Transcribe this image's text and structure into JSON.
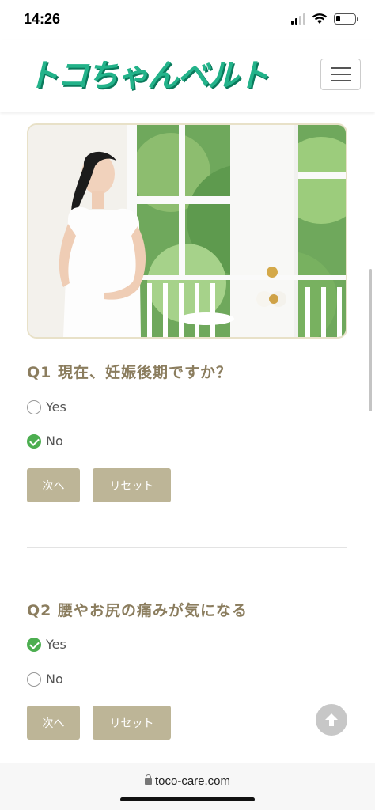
{
  "status_bar": {
    "time": "14:26"
  },
  "header": {
    "logo_text": "トコちゃんベルト",
    "menu_icon": "hamburger-menu-icon"
  },
  "questions": [
    {
      "title": "Q1 現在、妊娠後期ですか？",
      "options": [
        {
          "label": "Yes",
          "checked": false
        },
        {
          "label": "No",
          "checked": true
        }
      ],
      "next_label": "次へ",
      "reset_label": "リセット"
    },
    {
      "title": "Q2 腰やお尻の痛みが気になる",
      "options": [
        {
          "label": "Yes",
          "checked": true
        },
        {
          "label": "No",
          "checked": false
        }
      ],
      "next_label": "次へ",
      "reset_label": "リセット"
    }
  ],
  "browser": {
    "url": "toco-care.com"
  },
  "colors": {
    "brand": "#23b38a",
    "question_title": "#8b7d5e",
    "button": "#bdb597",
    "checked": "#4cae50"
  }
}
